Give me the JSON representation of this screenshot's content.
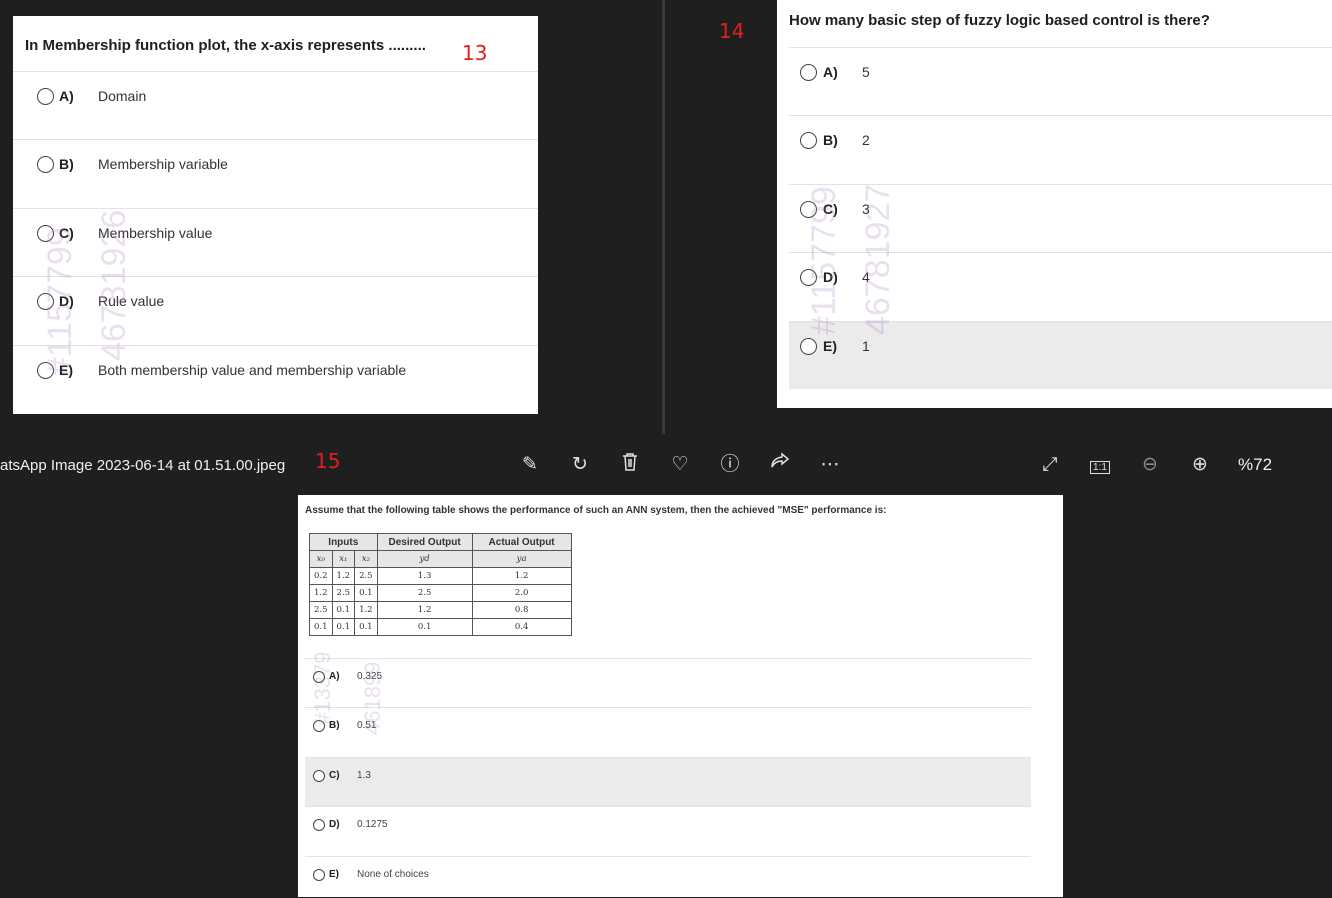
{
  "q13": {
    "number": "13",
    "question": "In Membership function plot, the  x-axis represents .........",
    "options": [
      {
        "letter": "A)",
        "text": "Domain"
      },
      {
        "letter": "B)",
        "text": "Membership variable"
      },
      {
        "letter": "C)",
        "text": "Membership value"
      },
      {
        "letter": "D)",
        "text": "Rule value"
      },
      {
        "letter": "E)",
        "text": "Both membership value and membership variable"
      }
    ]
  },
  "q14": {
    "number": "14",
    "question": "How many basic step of fuzzy logic based control is there?",
    "options": [
      {
        "letter": "A)",
        "text": "5"
      },
      {
        "letter": "B)",
        "text": "2"
      },
      {
        "letter": "C)",
        "text": "3"
      },
      {
        "letter": "D)",
        "text": "4"
      },
      {
        "letter": "E)",
        "text": "1"
      }
    ]
  },
  "q15": {
    "number": "15",
    "question": "Assume that the following table shows the performance of such an ANN system, then the achieved \"MSE\" performance is:",
    "table": {
      "headers": [
        "Inputs",
        "Desired Output",
        "Actual Output"
      ],
      "subheaders": [
        "x₀",
        "x₁",
        "x₂",
        "yd",
        "ya"
      ],
      "rows": [
        [
          "0.2",
          "1.2",
          "2.5",
          "1.3",
          "1.2"
        ],
        [
          "1.2",
          "2.5",
          "0.1",
          "2.5",
          "2.0"
        ],
        [
          "2.5",
          "0.1",
          "1.2",
          "1.2",
          "0.8"
        ],
        [
          "0.1",
          "0.1",
          "0.1",
          "0.1",
          "0.4"
        ]
      ]
    },
    "options": [
      {
        "letter": "A)",
        "text": "0.325"
      },
      {
        "letter": "B)",
        "text": "0.51"
      },
      {
        "letter": "C)",
        "text": "1.3"
      },
      {
        "letter": "D)",
        "text": "0.1275"
      },
      {
        "letter": "E)",
        "text": "None of choices"
      }
    ]
  },
  "watermarks": {
    "id_a": "#1157799",
    "id_b": "46781927",
    "id_c": "46781926",
    "id_d": "#1157799",
    "id_e": "#13379",
    "id_f": "461899"
  },
  "viewer": {
    "filename": "atsApp Image 2023-06-14 at 01.51.00.jpeg",
    "zoom": "%72",
    "actual_size": "1:1",
    "icons": [
      "edit-icon",
      "rotate-icon",
      "delete-icon",
      "favorite-icon",
      "info-icon",
      "share-icon",
      "more-icon",
      "fullscreen-icon",
      "actual-size-icon",
      "zoom-out-icon",
      "zoom-in-icon"
    ]
  }
}
